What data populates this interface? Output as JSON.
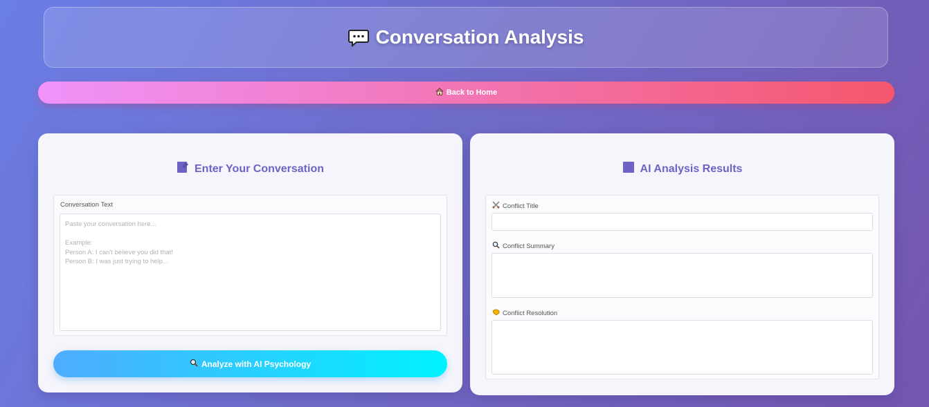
{
  "header": {
    "title": "Conversation Analysis",
    "icon": "speech-bubble-icon"
  },
  "nav": {
    "back_label": "Back to Home",
    "back_icon": "home-icon"
  },
  "input_panel": {
    "title": "Enter Your Conversation",
    "title_icon": "memo-icon",
    "field_label": "Conversation Text",
    "placeholder": "Paste your conversation here...\n\nExample:\nPerson A: I can't believe you did that!\nPerson B: I was just trying to help...",
    "value": "",
    "analyze_label": "Analyze with AI Psychology",
    "analyze_icon": "magnifier-icon"
  },
  "results_panel": {
    "title": "AI Analysis Results",
    "title_icon": "chart-icon",
    "conflict_title_label": "Conflict Title",
    "conflict_title_icon": "crossed-swords-icon",
    "conflict_title_value": "",
    "conflict_summary_label": "Conflict Summary",
    "conflict_summary_icon": "magnifier-icon",
    "conflict_summary_value": "",
    "conflict_resolution_label": "Conflict Resolution",
    "conflict_resolution_icon": "handshake-icon",
    "conflict_resolution_value": ""
  },
  "colors": {
    "accent": "#6c63c4",
    "back_gradient_start": "#f093fb",
    "back_gradient_end": "#f5576c",
    "analyze_gradient_start": "#4facfe",
    "analyze_gradient_end": "#00f2fe"
  }
}
